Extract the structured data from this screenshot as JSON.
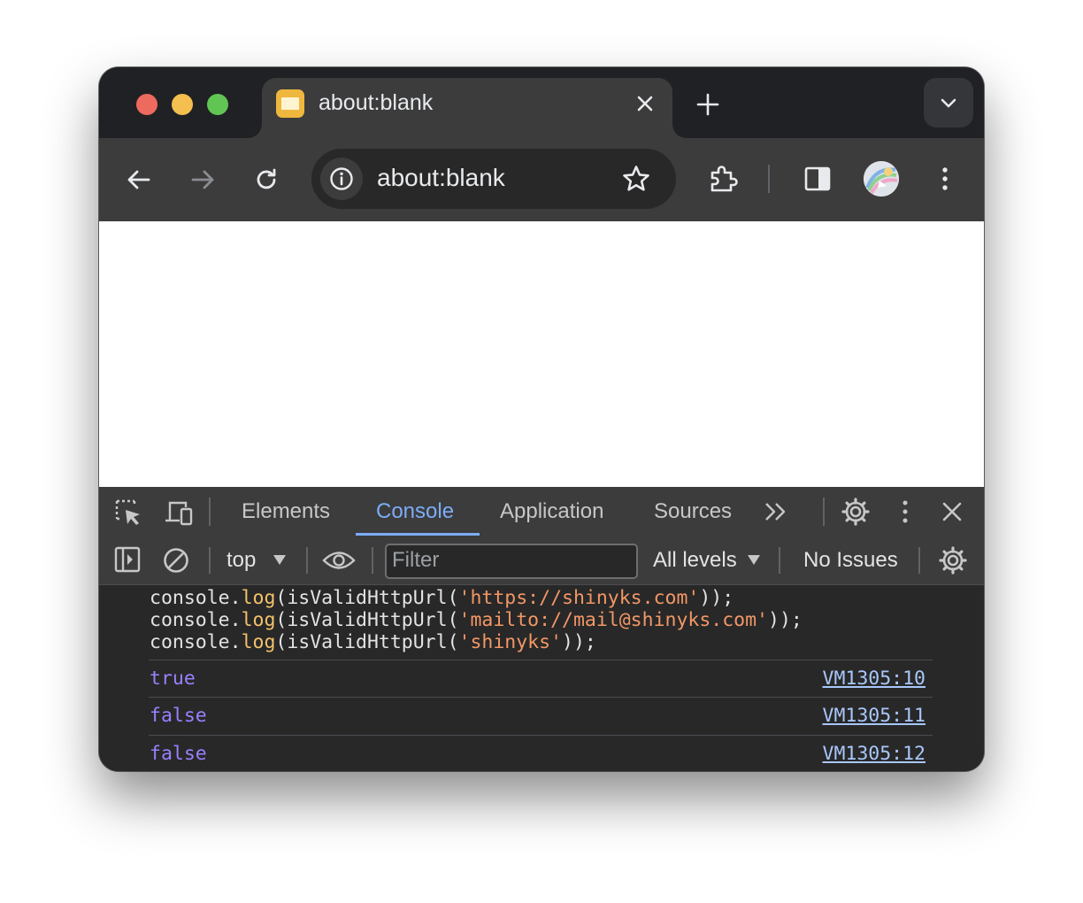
{
  "tab": {
    "title": "about:blank"
  },
  "omnibox": {
    "url": "about:blank"
  },
  "devtools": {
    "tabs": [
      "Elements",
      "Console",
      "Application",
      "Sources"
    ],
    "active_tab": "Console",
    "context": "top",
    "filter_placeholder": "Filter",
    "levels": "All levels",
    "issues": "No Issues"
  },
  "console": {
    "input_lines": [
      {
        "prefix": "console.",
        "fn": "log",
        "open": "(isValidHttpUrl(",
        "arg": "'https://shinyks.com'",
        "close": "));"
      },
      {
        "prefix": "console.",
        "fn": "log",
        "open": "(isValidHttpUrl(",
        "arg": "'mailto://mail@shinyks.com'",
        "close": "));"
      },
      {
        "prefix": "console.",
        "fn": "log",
        "open": "(isValidHttpUrl(",
        "arg": "'shinyks'",
        "close": "));"
      }
    ],
    "outputs": [
      {
        "value": "true",
        "source": "VM1305:10"
      },
      {
        "value": "false",
        "source": "VM1305:11"
      },
      {
        "value": "false",
        "source": "VM1305:12"
      }
    ]
  },
  "colors": {
    "accent": "#7cacf8",
    "boolean": "#9980ff",
    "string": "#f29766",
    "function": "#f5c26b",
    "link": "#a8c7fa"
  }
}
